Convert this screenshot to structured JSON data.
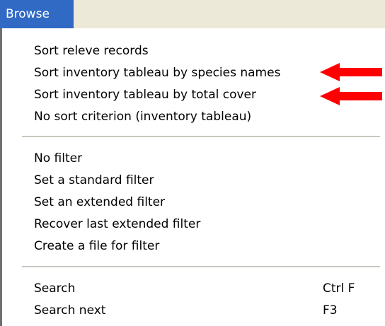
{
  "menubar": {
    "title": "Browse"
  },
  "menu": {
    "group1": [
      {
        "label": "Sort releve records"
      },
      {
        "label": "Sort inventory tableau by species names"
      },
      {
        "label": "Sort inventory tableau by total cover"
      },
      {
        "label": "No sort criterion (inventory tableau)"
      }
    ],
    "group2": [
      {
        "label": "No filter"
      },
      {
        "label": "Set a standard filter"
      },
      {
        "label": "Set an extended filter"
      },
      {
        "label": "Recover last extended filter"
      },
      {
        "label": "Create a file for filter"
      }
    ],
    "group3": [
      {
        "label": "Search",
        "shortcut": "Ctrl F"
      },
      {
        "label": "Search next",
        "shortcut": "F3"
      }
    ]
  },
  "annotations": {
    "arrow_color": "#ff0000",
    "arrow_icon": "left-arrow"
  },
  "colors": {
    "menubar_highlight": "#316ac5",
    "menubar_bg": "#ece9d8"
  }
}
